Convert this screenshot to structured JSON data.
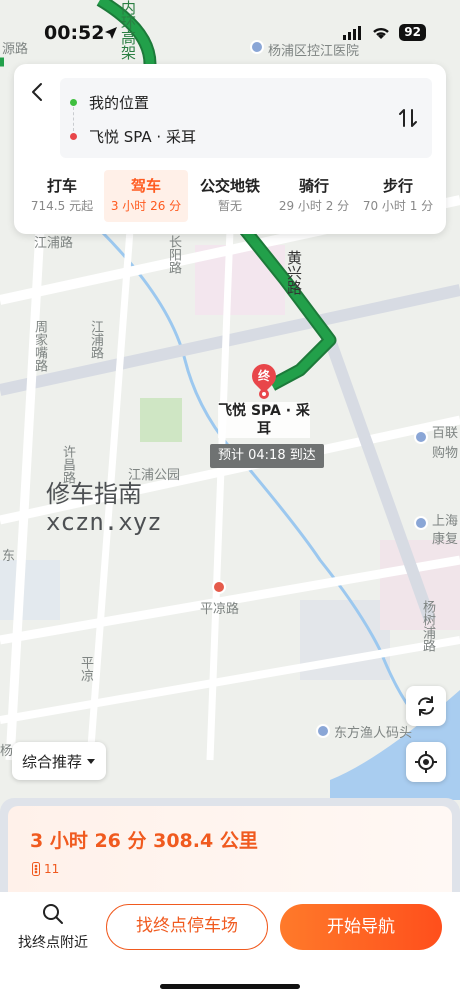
{
  "status_bar": {
    "time": "00:52",
    "battery": "92"
  },
  "route": {
    "origin": "我的位置",
    "destination": "飞悦 SPA · 采耳",
    "origin_color": "#3fbf3f",
    "destination_color": "#e8464a"
  },
  "modes": [
    {
      "name": "打车",
      "sub": "714.5 元起",
      "active": false
    },
    {
      "name": "驾车",
      "sub": "3 小时 26 分",
      "active": true
    },
    {
      "name": "公交地铁",
      "sub": "暂无",
      "active": false
    },
    {
      "name": "骑行",
      "sub": "29 小时 2 分",
      "active": false
    },
    {
      "name": "步行",
      "sub": "70 小时 1 分",
      "active": false
    }
  ],
  "map": {
    "dest_badge": "终",
    "dest_name": "飞悦 SPA · 采耳",
    "arrive": "预计 04:18 到达",
    "watermark": "修车指南",
    "watermark_url": "xczn.xyz",
    "route_color": "#22a04a",
    "labels": {
      "yangpu_hospital": "杨浦区控江医院",
      "jiangpu_road": "江浦路",
      "huangxing_road": "黄兴路",
      "jiangpu_park": "江浦公园",
      "pingliang_road": "平凉路",
      "dongfang_pier": "东方渔人码头",
      "bailian": "百联",
      "gouwu": "购物",
      "shanghai": "上海",
      "kangfu": "康复",
      "zhoujiazui_road": "周家嘴路",
      "changyang_road": "长阳路",
      "xuchang_road": "许昌路",
      "pingliang": "平凉",
      "neihuan": "内环高架",
      "yangshupu": "杨树浦路",
      "jiangpu_v": "江浦路",
      "dong": "东",
      "yang": "杨",
      "yuan": "源路",
      "gao": "高"
    }
  },
  "controls": {
    "sort_label": "综合推荐"
  },
  "plan": {
    "summary": "3 小时 26 分  308.4 公里",
    "lights": "11"
  },
  "actions": {
    "nearby": "找终点附近",
    "parking": "找终点停车场",
    "navigate": "开始导航"
  }
}
